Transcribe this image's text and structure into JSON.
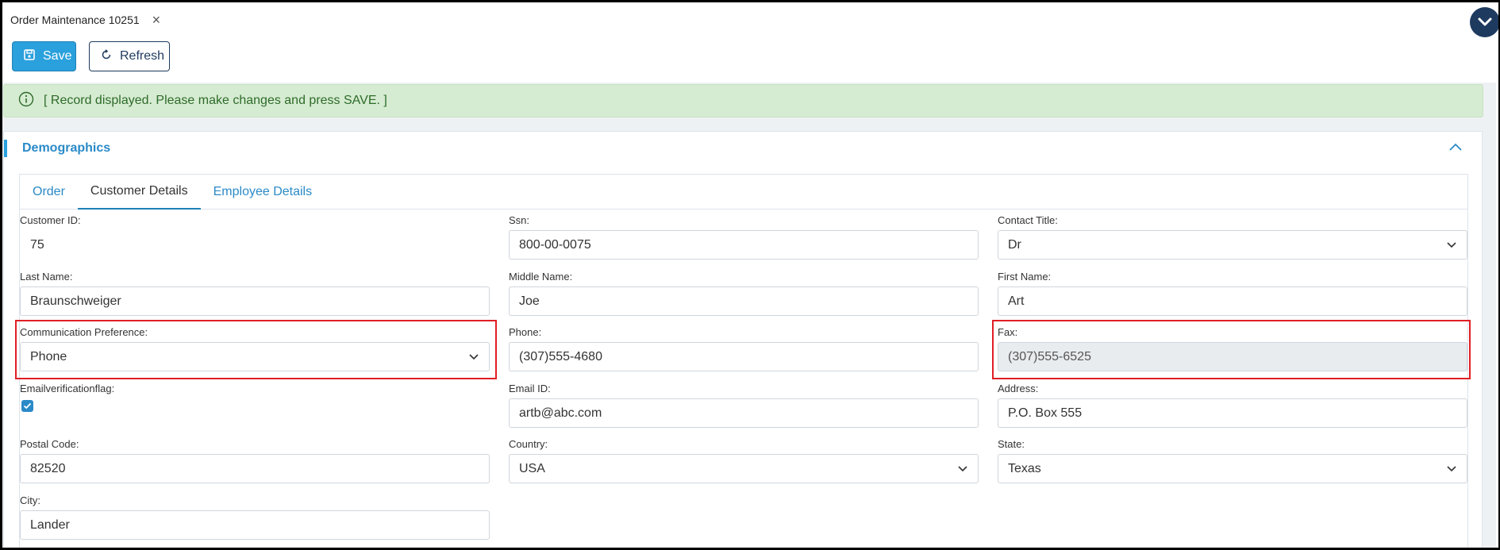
{
  "window_tab": {
    "title": "Order Maintenance 10251",
    "close_glyph": "×"
  },
  "toolbar": {
    "save_label": "Save",
    "refresh_label": "Refresh"
  },
  "alert": {
    "message": "[ Record displayed. Please make changes and press SAVE. ]"
  },
  "panel": {
    "title": "Demographics"
  },
  "tabs": [
    {
      "label": "Order",
      "active": false
    },
    {
      "label": "Customer Details",
      "active": true
    },
    {
      "label": "Employee Details",
      "active": false
    }
  ],
  "form": {
    "customer_id": {
      "label": "Customer ID:",
      "value": "75"
    },
    "ssn": {
      "label": "Ssn:",
      "value": "800-00-0075"
    },
    "contact_title": {
      "label": "Contact Title:",
      "value": "Dr"
    },
    "last_name": {
      "label": "Last Name:",
      "value": "Braunschweiger"
    },
    "middle_name": {
      "label": "Middle Name:",
      "value": "Joe"
    },
    "first_name": {
      "label": "First Name:",
      "value": "Art"
    },
    "communication_preference": {
      "label": "Communication Preference:",
      "value": "Phone"
    },
    "phone": {
      "label": "Phone:",
      "value": "(307)555-4680"
    },
    "fax": {
      "label": "Fax:",
      "value": "(307)555-6525"
    },
    "email_verification_flag": {
      "label": "Emailverificationflag:",
      "checked": true
    },
    "email_id": {
      "label": "Email ID:",
      "value": "artb@abc.com"
    },
    "address": {
      "label": "Address:",
      "value": "P.O. Box 555"
    },
    "postal_code": {
      "label": "Postal Code:",
      "value": "82520"
    },
    "country": {
      "label": "Country:",
      "value": "USA"
    },
    "state": {
      "label": "State:",
      "value": "Texas"
    },
    "city": {
      "label": "City:",
      "value": "Lander"
    }
  },
  "colors": {
    "accent": "#2aa0dc",
    "navy": "#1e3a5f",
    "success_bg": "#d6ecd2",
    "highlight": "#e01e25"
  },
  "icons": [
    "close-icon",
    "chevron-down-circle-icon",
    "save-icon",
    "refresh-icon",
    "info-icon",
    "chevron-up-icon",
    "chevron-down-icon",
    "check-icon"
  ]
}
